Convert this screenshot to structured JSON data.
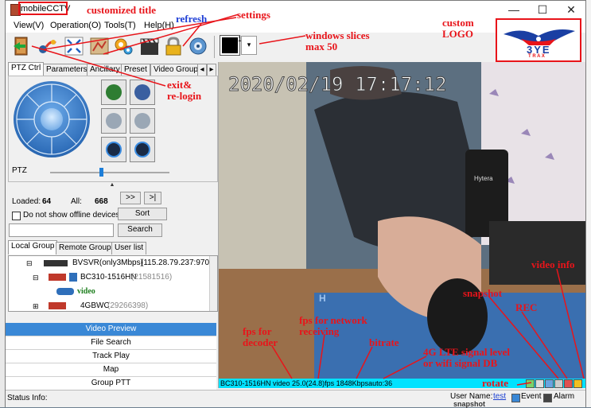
{
  "window": {
    "title": "mobileCCTV",
    "controls": {
      "minimize": "—",
      "maximize": "☐",
      "close": "✕"
    }
  },
  "menu": [
    "View(V)",
    "Operation(O)",
    "Tools(T)",
    "Help(H)"
  ],
  "toolbar": {
    "buttons": [
      "exit-icon",
      "fullscreen-icon",
      "map-icon",
      "settings-icon",
      "video-clip-icon",
      "lock-icon",
      "refresh-icon"
    ],
    "slice_selector_value": "1"
  },
  "annotations": {
    "title": "customized title",
    "refresh": "refresh",
    "settings": "settings",
    "slices": "windows slices\nmax 50",
    "logo": "custom\nLOGO",
    "exit": "exit&\nre-login",
    "fps_decoder": "fps for\ndecoder",
    "fps_network": "fps for network\nreceiving",
    "bitrate": "bitrate",
    "signal": "4G LTE signal level\nor wifi signal DB",
    "snapshot": "snapshot",
    "rec": "REC",
    "video_info": "video info",
    "rotate": "rotate"
  },
  "logo": {
    "text": "3YE",
    "subtext": "T R A X"
  },
  "left_tabs": [
    "PTZ Ctrl",
    "Parameters",
    "Ancillary",
    "Preset",
    "Video Group"
  ],
  "ptz": {
    "label": "PTZ"
  },
  "device_stats": {
    "loaded_label": "Loaded:",
    "loaded_value": "64",
    "all_label": "All:",
    "all_value": "668",
    "next_btn": ">>",
    "last_btn": ">|",
    "hide_offline_label": "Do not show offline devices",
    "sort_btn": "Sort",
    "search_btn": "Search",
    "search_value": ""
  },
  "group_tabs": [
    "Local Group",
    "Remote Group",
    "User list"
  ],
  "tree": [
    {
      "name": "BVSVR(only3Mbps)",
      "detail": "(115.28.79.237:9701)"
    },
    {
      "name": "BC310-1516HN",
      "detail": "(21581516)"
    },
    {
      "name": "video",
      "detail": ""
    },
    {
      "name": "4GBWC",
      "detail": "(29266398)"
    }
  ],
  "nav_items": [
    "Video Preview",
    "File Search",
    "Track Play",
    "Map",
    "Group PTT"
  ],
  "video": {
    "timestamp": "2020/02/19 17:17:12",
    "camera_brand": "Hytera",
    "mousepad_text": "H"
  },
  "video_status": "BC310-1516HN video  25.0(24.8)fps 1848Kbpsauto:36",
  "status": {
    "label": "Status Info:",
    "user_label": "User Name:",
    "user_value": "test",
    "event_label": "Event",
    "alarm_label": "Alarm"
  },
  "background": {
    "snapshot_text": "snapshot"
  }
}
